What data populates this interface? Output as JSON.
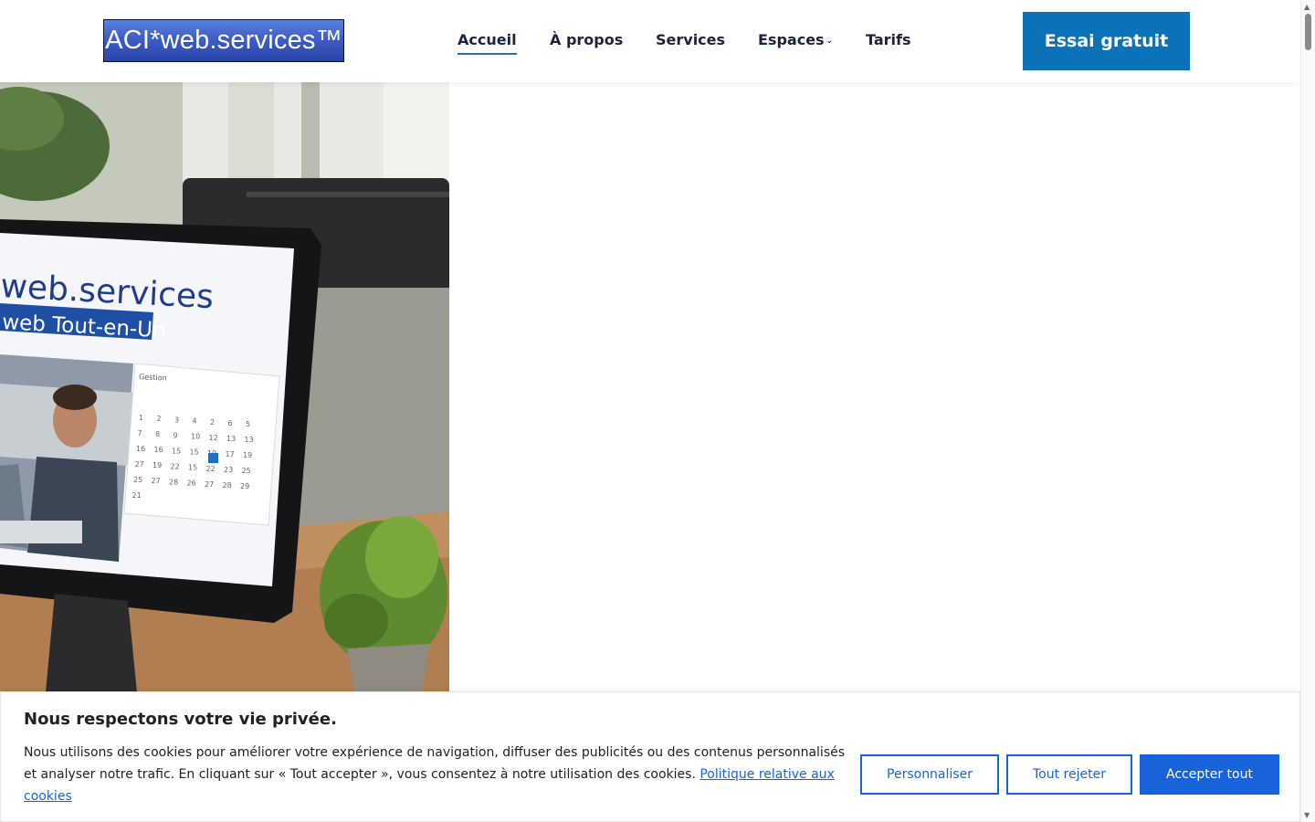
{
  "header": {
    "logo_text": "ACI*web.services™",
    "nav": [
      {
        "label": "Accueil"
      },
      {
        "label": "À propos"
      },
      {
        "label": "Services"
      },
      {
        "label": "Espaces"
      },
      {
        "label": "Tarifs"
      }
    ],
    "cta_label": "Essai gratuit"
  },
  "hero": {
    "screen_brand": "web.services",
    "screen_tagline": "web Tout-en-Un",
    "calendar_title": "Gestion",
    "calendar_days": [
      "1",
      "2",
      "3",
      "4",
      "2",
      "6",
      "5",
      "7",
      "8",
      "9",
      "10",
      "12",
      "13",
      "13",
      "16",
      "16",
      "15",
      "15",
      "19",
      "17",
      "19",
      "27",
      "19",
      "22",
      "15",
      "22",
      "23",
      "25",
      "25",
      "27",
      "28",
      "26",
      "27",
      "28",
      "29",
      "21"
    ]
  },
  "cookie": {
    "title": "Nous respectons votre vie privée.",
    "body": "Nous utilisons des cookies pour améliorer votre expérience de navigation, diffuser des publicités ou des contenus personnalisés et analyser notre trafic. En cliquant sur « Tout accepter », vous consentez à notre utilisation des cookies.",
    "policy_link": "Politique relative aux cookies",
    "btn_customize": "Personnaliser",
    "btn_reject": "Tout rejeter",
    "btn_accept": "Accepter tout"
  },
  "colors": {
    "primary": "#0b72b9",
    "cookie_accent": "#1863dc",
    "logo_bg": "#3e5ec8"
  }
}
